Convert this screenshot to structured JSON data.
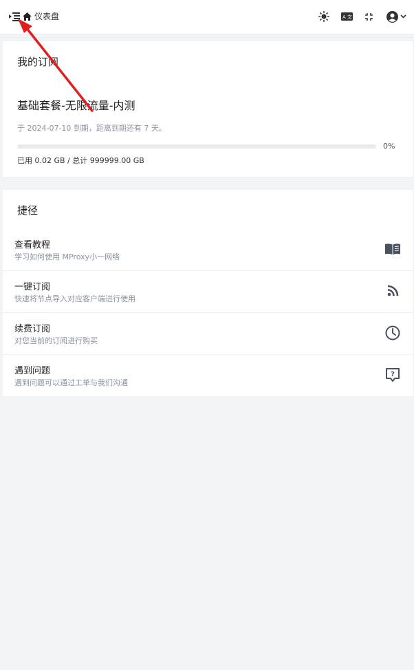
{
  "header": {
    "breadcrumb": "仪表盘",
    "icons": [
      "menu-toggle-icon",
      "home-icon",
      "sun-icon",
      "translate-icon",
      "fullscreen-icon",
      "user-avatar-icon",
      "chevron-down-icon"
    ]
  },
  "subscription": {
    "title": "我的订阅",
    "plan_name": "基础套餐-无限流量-内测",
    "expire_text": "于 2024-07-10 到期，距离到期还有 7 天。",
    "usage_percent": 0,
    "usage_percent_label": "0%",
    "usage_text": "已用 0.02 GB / 总计 999999.00 GB"
  },
  "shortcuts": {
    "title": "捷径",
    "items": [
      {
        "title": "查看教程",
        "desc": "学习如何使用 MProxy小一网络",
        "icon": "book-icon"
      },
      {
        "title": "一键订阅",
        "desc": "快速将节点导入对应客户端进行使用",
        "icon": "rss-icon"
      },
      {
        "title": "续费订阅",
        "desc": "对您当前的订阅进行购买",
        "icon": "clock-icon"
      },
      {
        "title": "遇到问题",
        "desc": "遇到问题可以通过工单与我们沟通",
        "icon": "help-message-icon"
      }
    ]
  },
  "colors": {
    "accent": "#3b82f6",
    "annotation_arrow": "#e02020",
    "background": "#f1f3f6"
  }
}
